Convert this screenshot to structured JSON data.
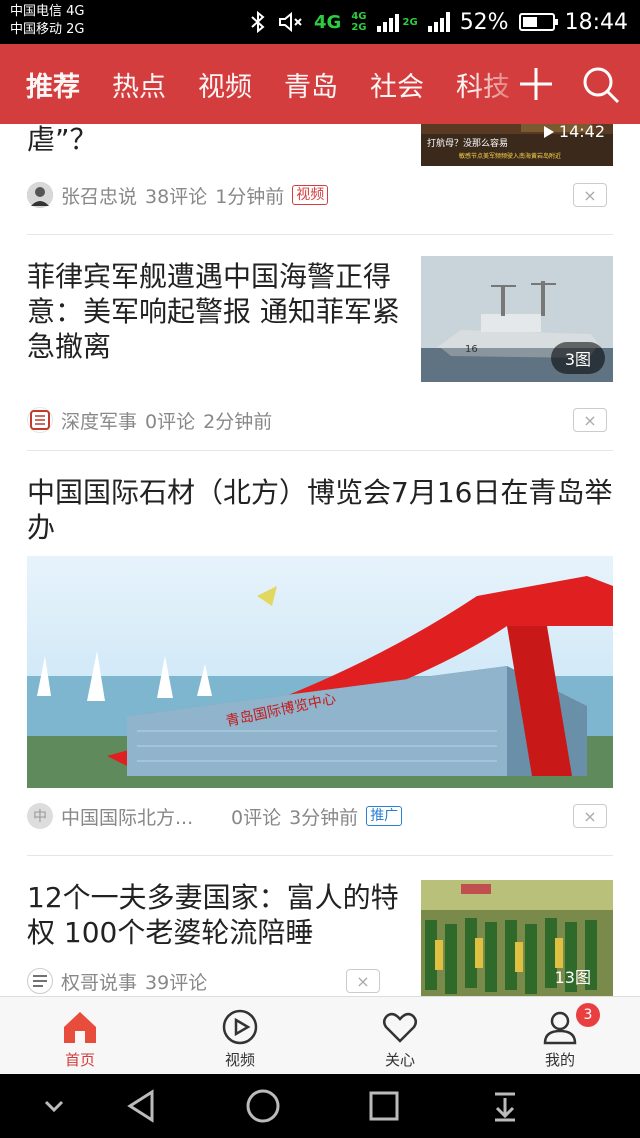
{
  "status_bar": {
    "carrier1": "中国电信 4G",
    "carrier2": "中国移动 2G",
    "net_main": "4G",
    "net_small_top": "4G",
    "net_small_bottom": "2G",
    "net_small_right": "2G",
    "battery_percent": "52%",
    "battery_level": 0.52,
    "time": "18:44"
  },
  "top_nav": {
    "tabs": [
      "推荐",
      "热点",
      "视频",
      "青岛",
      "社会",
      "科技"
    ],
    "active_tab": "推荐",
    "bg_color": "#d43d3d"
  },
  "feed": {
    "items": [
      {
        "title": "虐”？",
        "source": "张召忠说",
        "comments": "38评论",
        "time": "1分钟前",
        "tag": "视频",
        "duration": "14:42",
        "thumb_text_top": "打航母？没那么容易",
        "thumb_text_bottom": "敏感节点美军频频驶入南海黄岩岛附近"
      },
      {
        "title": "菲律宾军舰遭遇中国海警正得意：美军响起警报 通知菲军紧急撤离",
        "source": "深度军事",
        "comments": "0评论",
        "time": "2分钟前",
        "image_count": "3图",
        "ship_number": "16"
      },
      {
        "title": "中国国际石材（北方）博览会7月16日在青岛举办",
        "source_avatar": "中",
        "source": "中国国际北方...",
        "comments": "0评论",
        "time": "3分钟前",
        "tag": "推广",
        "banner_text": "青岛国际博览中心"
      },
      {
        "title": "12个一夫多妻国家：富人的特权 100个老婆轮流陪睡",
        "source": "权哥说事",
        "comments": "39评论",
        "image_count": "13图"
      }
    ],
    "dismiss_label": "×"
  },
  "bottom_bar": {
    "tabs": [
      {
        "label": "首页",
        "icon": "home-icon"
      },
      {
        "label": "视频",
        "icon": "play-icon"
      },
      {
        "label": "关心",
        "icon": "heart-icon"
      },
      {
        "label": "我的",
        "icon": "person-icon"
      }
    ],
    "profile_badge": "3",
    "accent_color": "#d43d3d"
  }
}
